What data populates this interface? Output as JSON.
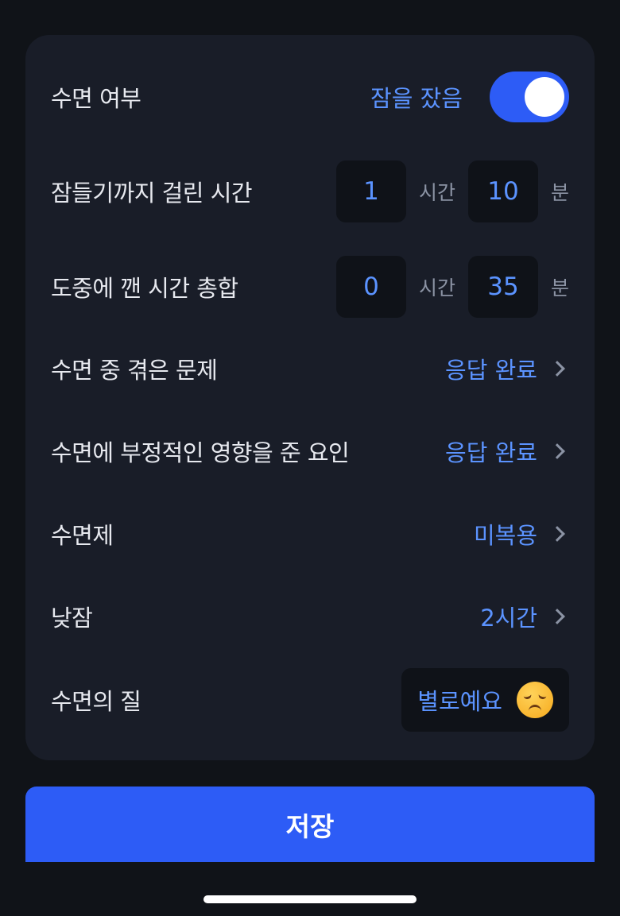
{
  "form": {
    "slept": {
      "label": "수면 여부",
      "value_text": "잠을 잤음",
      "toggle_on": true
    },
    "sleep_latency": {
      "label": "잠들기까지 걸린 시간",
      "hours": "1",
      "hour_unit": "시간",
      "minutes": "10",
      "minute_unit": "분"
    },
    "awake_time": {
      "label": "도중에 깬 시간 총합",
      "hours": "0",
      "hour_unit": "시간",
      "minutes": "35",
      "minute_unit": "분"
    },
    "problems": {
      "label": "수면 중 겪은 문제",
      "value": "응답 완료"
    },
    "negative_factors": {
      "label": "수면에 부정적인 영향을 준 요인",
      "value": "응답 완료"
    },
    "sleeping_pill": {
      "label": "수면제",
      "value": "미복용"
    },
    "nap": {
      "label": "낮잠",
      "value": "2시간"
    },
    "quality": {
      "label": "수면의 질",
      "value": "별로예요",
      "icon": "disappointed-face-icon"
    }
  },
  "save_button": {
    "label": "저장"
  },
  "colors": {
    "accent": "#5b93ff",
    "primary": "#2d5cf6",
    "card": "#191d28",
    "background": "#101318"
  }
}
